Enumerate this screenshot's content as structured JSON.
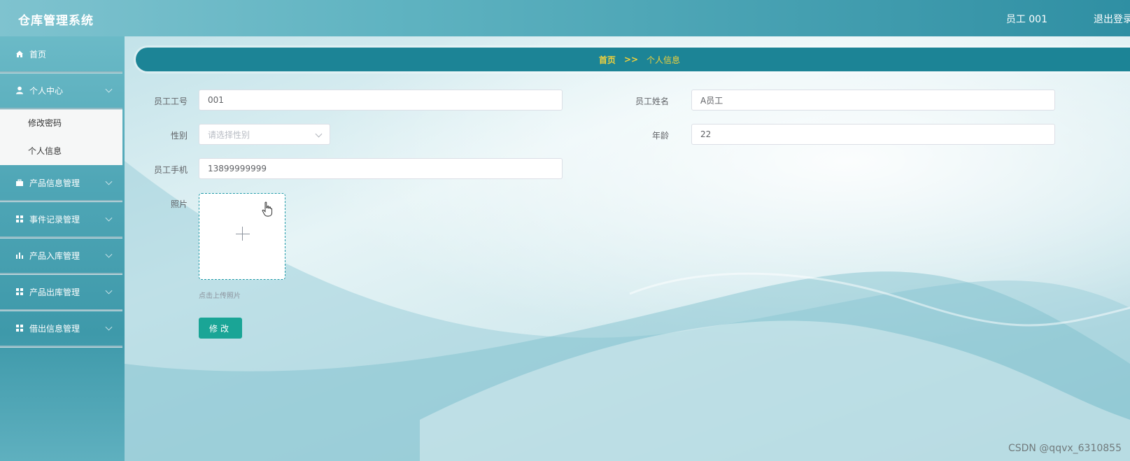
{
  "header": {
    "title": "仓库管理系统",
    "user": "员工 001",
    "logout": "退出登录"
  },
  "sidebar": {
    "items": [
      {
        "label": "首页",
        "icon": "home-icon"
      },
      {
        "label": "个人中心",
        "icon": "user-icon",
        "expanded": true,
        "children": [
          "修改密码",
          "个人信息"
        ]
      },
      {
        "label": "产品信息管理",
        "icon": "briefcase-icon"
      },
      {
        "label": "事件记录管理",
        "icon": "grid-icon"
      },
      {
        "label": "产品入库管理",
        "icon": "bar-chart-icon"
      },
      {
        "label": "产品出库管理",
        "icon": "grid-icon"
      },
      {
        "label": "借出信息管理",
        "icon": "grid-icon"
      }
    ]
  },
  "breadcrumb": {
    "home": "首页",
    "separator": ">>",
    "current": "个人信息"
  },
  "form": {
    "employee_id_label": "员工工号",
    "employee_id_value": "001",
    "employee_name_label": "员工姓名",
    "employee_name_value": "A员工",
    "gender_label": "性别",
    "gender_placeholder": "请选择性别",
    "age_label": "年龄",
    "age_value": "22",
    "phone_label": "员工手机",
    "phone_value": "13899999999",
    "photo_label": "照片",
    "photo_hint": "点击上传照片",
    "submit_label": "修改"
  },
  "watermark": "CSDN @qqvx_6310855",
  "colors": {
    "accent": "#1c8496",
    "breadcrumb_text": "#f3d23a",
    "button": "#1aa596"
  }
}
